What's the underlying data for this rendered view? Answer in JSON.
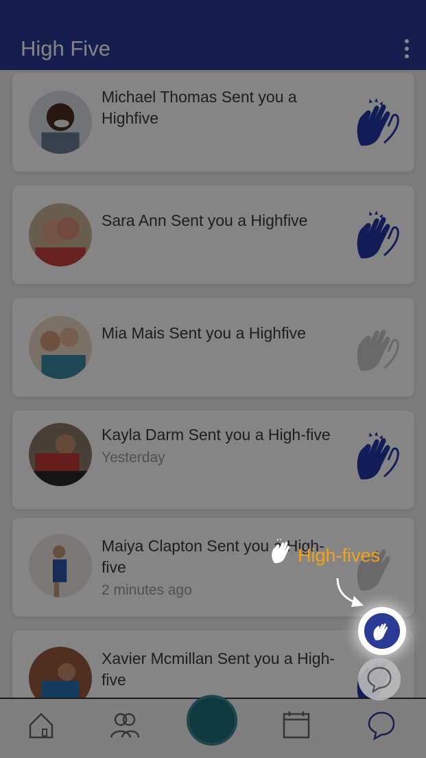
{
  "app": {
    "title": "High Five"
  },
  "notifications": [
    {
      "name": "Michael Thomas",
      "message": "Michael Thomas Sent you a Highfive",
      "time": "",
      "icon_state": "active"
    },
    {
      "name": "Sara Ann",
      "message": "Sara Ann Sent you a Highfive",
      "time": "",
      "icon_state": "active"
    },
    {
      "name": "Mia Mais",
      "message": "Mia Mais Sent you a Highfive",
      "time": "",
      "icon_state": "inactive"
    },
    {
      "name": "Kayla Darm",
      "message": "Kayla Darm Sent you a High-five",
      "time": "Yesterday",
      "icon_state": "active"
    },
    {
      "name": "Maiya Clapton",
      "message": "Maiya Clapton  Sent you a High-five",
      "time": "2 minutes ago",
      "icon_state": "inactive"
    },
    {
      "name": "Xavier Mcmillan",
      "message": "Xavier Mcmillan  Sent you a High-five",
      "time": "",
      "icon_state": "active"
    }
  ],
  "coach_mark": {
    "label": "High-fives",
    "label_color": "#f5a21b"
  },
  "colors": {
    "primary": "#2b3a94",
    "overlay": "rgba(0,0,0,0.48)",
    "icon_inactive": "#c9c9c9"
  },
  "icons": {
    "menu": "more-vert-icon",
    "high_five": "high-five-hand-icon",
    "home": "home-icon",
    "people": "people-icon",
    "team_logo": "team-logo",
    "calendar": "calendar-icon",
    "chat": "chat-bubble-icon"
  }
}
